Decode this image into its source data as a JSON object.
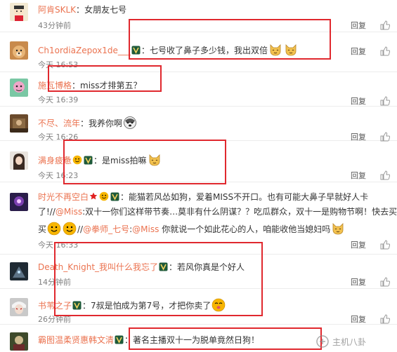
{
  "ui": {
    "reply_label": "回复"
  },
  "comments": [
    {
      "user": "阿肯SKLK",
      "sep": "：",
      "text": "女朋友七号",
      "time": "43分钟前"
    },
    {
      "user": "Ch1ordiaZepox1de___",
      "sep": "：",
      "text": "七号收了鼻子多少钱，我出双倍"
    },
    {
      "user": "施瓦博格",
      "sep": "：",
      "text": "miss才排第五？",
      "time": "今天 16:53"
    },
    {
      "user": "不尽、流年",
      "sep": "：",
      "text": "我养你啊",
      "time": "今天 16:39"
    },
    {
      "user": "满身疲惫",
      "sep": "：",
      "text": "是miss拍嘛",
      "time": "今天 16:26"
    },
    {
      "user": "时光不再空白",
      "sep": "：",
      "text_line1": "能猫若风怂如狗，爱着MISS不开口。也有可能大鼻子早就好人卡",
      "text_line2_a": "了!//",
      "mention_1": "@Miss",
      "text_line2_b": ":双十一你们这样带节奏…莫非有什么阴谋？？吃瓜群众，双十一是购物节啊！快去买买",
      "text_line3_a": "买",
      "text_line3_b": "//",
      "mention_2": "@拳师_七号",
      "text_line3_c": ":",
      "mention_3": "@Miss",
      "text_line3_d": " 你就说一个如此花心的人，咱能收他当媳妇吗",
      "time": "今天 16:23"
    },
    {
      "user": "Death_Knight_我叫什么我忘了",
      "sep": "：",
      "text": "若风你真是个好人",
      "time": "今天 16:33"
    },
    {
      "user": "书苇之子",
      "sep": "：",
      "text": "7叔是怕成为第7号，才把你卖了",
      "time": "14分钟前"
    },
    {
      "user": "霸图温柔贤惠韩文清",
      "sep": "：",
      "text": "著名主播双十一为脱单竟然日狗！",
      "time": "26分钟前"
    }
  ],
  "watermark": "主机八卦",
  "colors": {
    "username": "#eb7350",
    "text": "#333333",
    "time": "#808080",
    "highlight_box": "#e0282e"
  },
  "icons": [
    "like-thumb-icon",
    "vip-badge-icon",
    "fox-emoji-icon",
    "smile-emoji-icon",
    "husky-emoji-icon"
  ]
}
